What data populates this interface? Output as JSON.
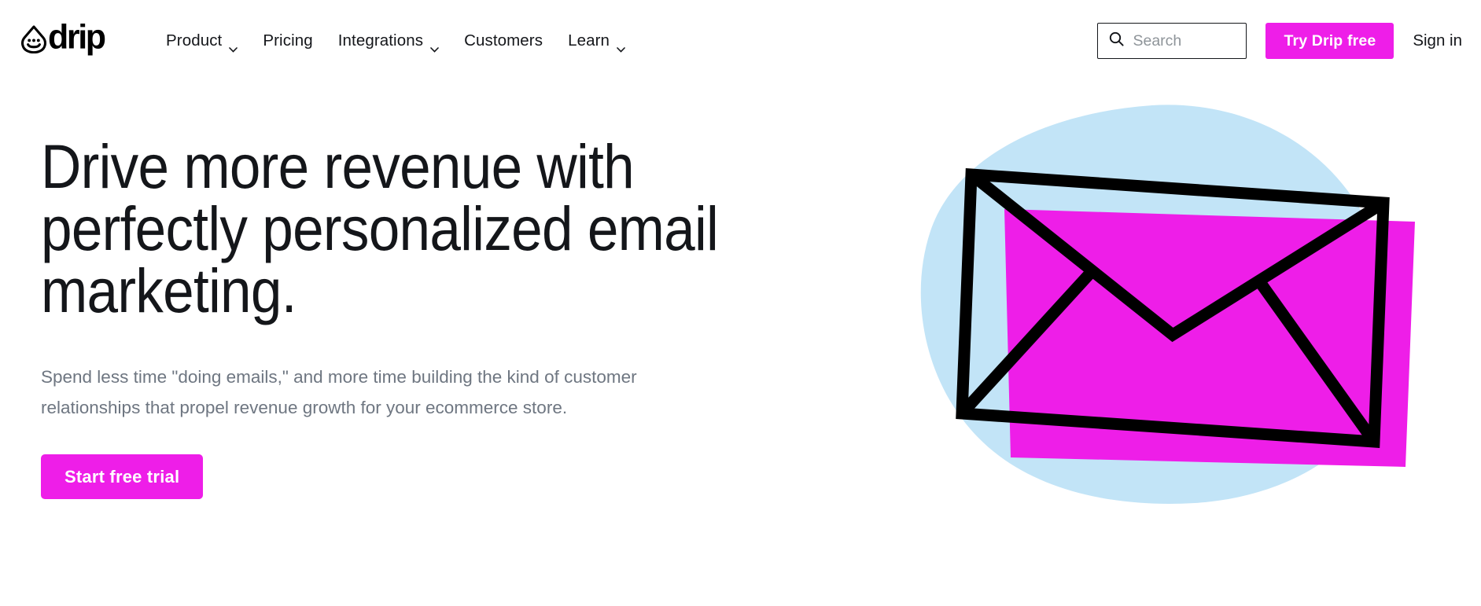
{
  "page": {
    "background": "#ffffff",
    "brand_magenta": "#ee1ee8",
    "blob_blue": "#c2e4f7",
    "text_dark": "#14161a",
    "text_muted": "#6e7681"
  },
  "header": {
    "logo": {
      "wordmark": "drip",
      "mark_icon": "drip-droplet-smiley-icon"
    },
    "nav_items": [
      {
        "label": "Product",
        "has_dropdown": true
      },
      {
        "label": "Pricing",
        "has_dropdown": false
      },
      {
        "label": "Integrations",
        "has_dropdown": true
      },
      {
        "label": "Customers",
        "has_dropdown": false
      },
      {
        "label": "Learn",
        "has_dropdown": true
      }
    ],
    "search": {
      "placeholder": "Search",
      "value": "",
      "icon": "search-icon"
    },
    "trial_button": {
      "label": "Try Drip free",
      "color": "#ee1ee8",
      "text_color": "#ffffff"
    },
    "signin_link": {
      "label": "Sign in"
    }
  },
  "hero": {
    "title": "Drive more revenue with\nperfectly personalized email\nmarketing.",
    "subtitle": "Spend less time \"doing emails,\" and more time building the kind of customer relationships that propel revenue growth for your ecommerce store.",
    "cta": {
      "label": "Start free trial",
      "color": "#ee1ee8",
      "text_color": "#ffffff"
    },
    "illustration": {
      "name": "envelope-illustration",
      "blob_color": "#c2e4f7",
      "card_color": "#ee1ee8",
      "outline_color": "#000000"
    }
  }
}
